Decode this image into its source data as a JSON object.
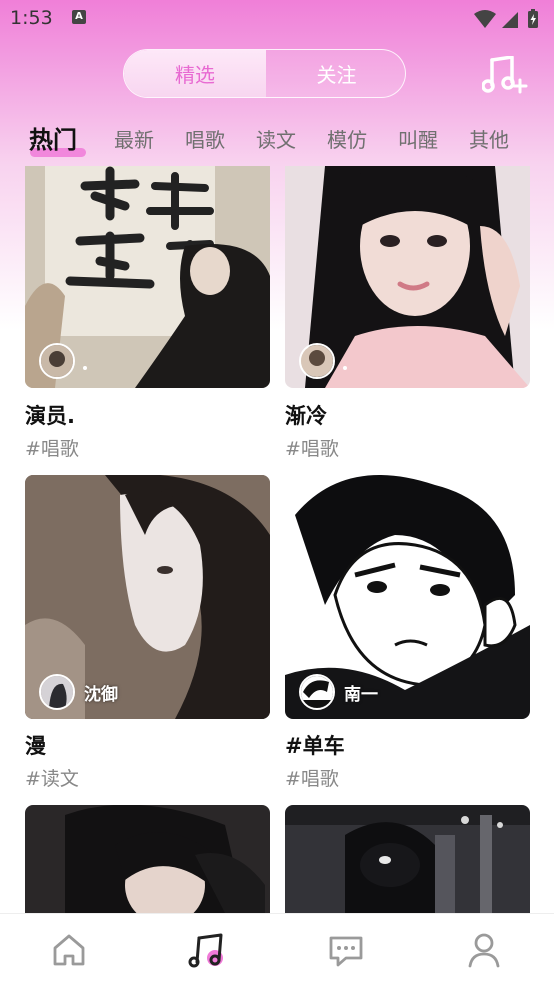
{
  "status_bar": {
    "time": "1:53",
    "notification_letter": "A"
  },
  "segment": {
    "active_label": "精选",
    "inactive_label": "关注"
  },
  "tabs": [
    {
      "label": "热门",
      "active": true
    },
    {
      "label": "最新"
    },
    {
      "label": "唱歌"
    },
    {
      "label": "读文"
    },
    {
      "label": "模仿"
    },
    {
      "label": "叫醒"
    },
    {
      "label": "其他"
    }
  ],
  "cards": [
    {
      "title": "演员.",
      "tag": "#唱歌",
      "author": ""
    },
    {
      "title": "渐冷",
      "tag": "#唱歌",
      "author": ""
    },
    {
      "title": "漫",
      "tag": "#读文",
      "author": "沈御"
    },
    {
      "title": "#单车",
      "tag": "#唱歌",
      "author": "南一"
    },
    {
      "title": "",
      "tag": "",
      "author": ""
    },
    {
      "title": "",
      "tag": "",
      "author": ""
    }
  ],
  "colors": {
    "accent": "#f07ad8",
    "gradient_top": "#f07fd8"
  },
  "bottom_nav": [
    "home-icon",
    "music-icon",
    "message-icon",
    "profile-icon"
  ]
}
